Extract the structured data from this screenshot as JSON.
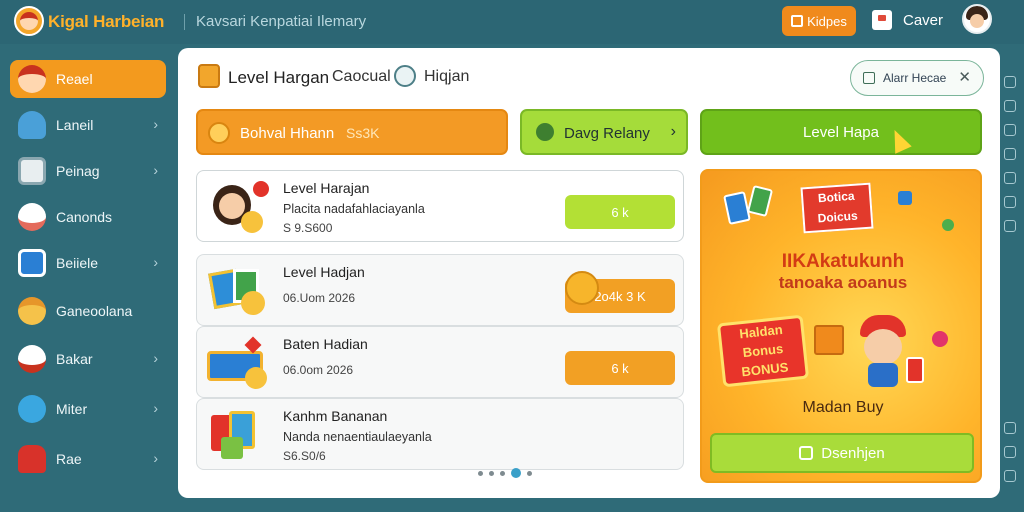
{
  "topbar": {
    "app_title": "Kigal Harbeian",
    "subtitle": "Kavsari Kenpatiai Ilemary",
    "primary_button": "Kidpes",
    "user_label": "Caver"
  },
  "sidebar": {
    "items": [
      {
        "label": "Reael",
        "icon": "kid-icon",
        "active": true
      },
      {
        "label": "Laneil",
        "icon": "skater-icon",
        "chevron": true
      },
      {
        "label": "Peinag",
        "icon": "receipt-icon",
        "chevron": true
      },
      {
        "label": "Canonds",
        "icon": "chef-icon",
        "chevron": false
      },
      {
        "label": "Beiiele",
        "icon": "card-icon",
        "chevron": true
      },
      {
        "label": "Ganeoolana",
        "icon": "builder-icon",
        "chevron": false
      },
      {
        "label": "Bakar",
        "icon": "dog-icon",
        "chevron": true
      },
      {
        "label": "Miter",
        "icon": "play-icon",
        "chevron": true
      },
      {
        "label": "Rae",
        "icon": "car-icon",
        "chevron": true
      }
    ]
  },
  "header": {
    "title": "Level Hargan",
    "sub1": "Caocual",
    "sub2": "Hiqjan",
    "pill_label": "Alarr Hecae"
  },
  "actions": {
    "search_label": "Bohval Hhann",
    "search_hint": "Ss3K",
    "middle_label": "Davg Relany",
    "main_label": "Level Hapa"
  },
  "list": [
    {
      "title": "Level Harajan",
      "desc": "Placita nadafahlaciayanla",
      "meta": "S 9.S600",
      "button": "6 k",
      "style": "green"
    },
    {
      "title": "Level Hadjan",
      "desc": "",
      "meta": "06.Uom  2026",
      "button": "2o4k  3 K",
      "style": "orange"
    },
    {
      "title": "Baten Hadian",
      "desc": "",
      "meta": "06.0om  2026",
      "button": "6 k",
      "style": "orange"
    },
    {
      "title": "Kanhm Bananan",
      "desc": "Nanda nenaentiaulaeyanla",
      "meta": "S6.S0/6",
      "button": "",
      "style": "none"
    }
  ],
  "promo": {
    "banner": [
      "Botica",
      "Doicus"
    ],
    "headline1": "IIKAkatukunh",
    "headline2": "tanoaka aoanus",
    "burst": [
      "Haldan",
      "Bonus",
      "BONUS"
    ],
    "caption": "Madan Buy",
    "button": "Dsenhjen"
  },
  "colors": {
    "accent_orange": "#f39a1e",
    "accent_green": "#72bf1c",
    "topbar": "#2c6674"
  }
}
